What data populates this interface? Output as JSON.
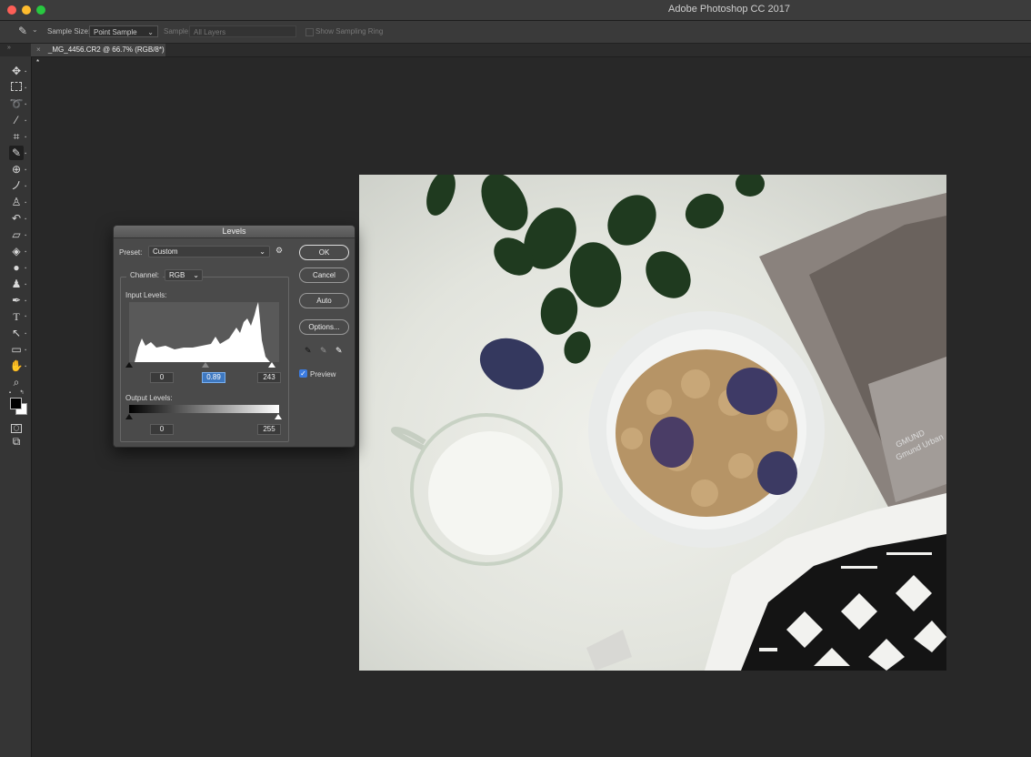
{
  "window": {
    "title": "Adobe Photoshop CC 2017"
  },
  "options_bar": {
    "sample_size_label": "Sample Size:",
    "sample_size_value": "Point Sample",
    "sample_label": "Sample:",
    "sample_value": "All Layers",
    "show_sampling_ring": "Show Sampling Ring"
  },
  "document_tab": {
    "label": "_MG_4456.CR2 @ 66.7% (RGB/8*) *",
    "close": "×"
  },
  "tools": [
    "move-icon",
    "marquee-icon",
    "lasso-icon",
    "magic-wand-icon",
    "crop-icon",
    "eyedropper-icon",
    "healing-icon",
    "brush-icon",
    "stamp-icon",
    "history-brush-icon",
    "eraser-icon",
    "paint-bucket-icon",
    "blur-icon",
    "dodge-icon",
    "pen-icon",
    "type-icon",
    "path-select-icon",
    "shape-icon",
    "hand-icon",
    "zoom-icon",
    "more-tools-icon"
  ],
  "levels_dialog": {
    "title": "Levels",
    "preset_label": "Preset:",
    "preset_value": "Custom",
    "channel_label": "Channel:",
    "channel_value": "RGB",
    "input_levels_label": "Input Levels:",
    "output_levels_label": "Output Levels:",
    "input_black": "0",
    "input_gamma": "0.89",
    "input_white": "243",
    "output_black": "0",
    "output_white": "255",
    "buttons": {
      "ok": "OK",
      "cancel": "Cancel",
      "auto": "Auto",
      "options": "Options..."
    },
    "preview_label": "Preview",
    "preview_checked": true
  },
  "colors": {
    "accent": "#3b7be0",
    "background": "#282828",
    "panel": "#4a4a4a"
  }
}
